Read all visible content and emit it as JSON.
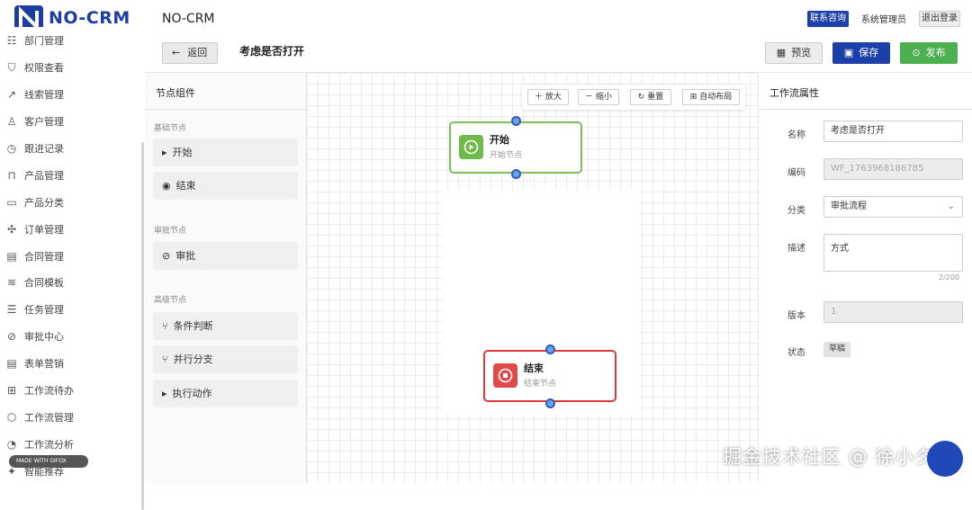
{
  "brand": {
    "name": "NO-CRM"
  },
  "header": {
    "app_title": "NO-CRM",
    "contact_label": "联系咨询",
    "user_label": "系统管理员",
    "logout_label": "退出登录"
  },
  "subheader": {
    "back_label": "返回",
    "page_title": "考虑是否打开",
    "preview_label": "预览",
    "save_label": "保存",
    "publish_label": "发布"
  },
  "sidebar": {
    "items": [
      {
        "label": "部门管理",
        "icon": "users-icon"
      },
      {
        "label": "权限查看",
        "icon": "shield-icon"
      },
      {
        "label": "线索管理",
        "icon": "chart-line-icon"
      },
      {
        "label": "客户管理",
        "icon": "user-icon"
      },
      {
        "label": "跟进记录",
        "icon": "clock-icon"
      },
      {
        "label": "产品管理",
        "icon": "bag-icon"
      },
      {
        "label": "产品分类",
        "icon": "folder-icon"
      },
      {
        "label": "订单管理",
        "icon": "move-icon"
      },
      {
        "label": "合同管理",
        "icon": "file-icon"
      },
      {
        "label": "合同模板",
        "icon": "layers-icon"
      },
      {
        "label": "任务管理",
        "icon": "list-icon"
      },
      {
        "label": "审批中心",
        "icon": "check-circle-icon"
      },
      {
        "label": "表单营销",
        "icon": "form-icon"
      },
      {
        "label": "工作流待办",
        "icon": "grid-icon"
      },
      {
        "label": "工作流管理",
        "icon": "box-icon"
      },
      {
        "label": "工作流分析",
        "icon": "pie-icon"
      },
      {
        "label": "智能推荐",
        "icon": "star-icon"
      }
    ],
    "gifox_label": "MADE WITH GIFOX"
  },
  "components": {
    "title": "节点组件",
    "groups": [
      {
        "label": "基础节点",
        "items": [
          "开始",
          "结束"
        ]
      },
      {
        "label": "审批节点",
        "items": [
          "审批"
        ]
      },
      {
        "label": "高级节点",
        "items": [
          "条件判断",
          "并行分支",
          "执行动作"
        ]
      }
    ]
  },
  "canvas": {
    "toolbar": {
      "zoom_in": "放大",
      "zoom_out": "缩小",
      "reset": "重置",
      "auto_layout": "自动布局"
    },
    "nodes": [
      {
        "name": "开始",
        "sub": "开始节点"
      },
      {
        "name": "结束",
        "sub": "结束节点"
      }
    ]
  },
  "properties": {
    "title": "工作流属性",
    "name_label": "名称",
    "name_value": "考虑是否打开",
    "code_label": "编码",
    "code_value": "WF_1763968186785",
    "category_label": "分类",
    "category_value": "审批流程",
    "desc_label": "描述",
    "desc_value": "方式",
    "desc_counter": "2/200",
    "version_label": "版本",
    "version_value": "1",
    "status_label": "状态",
    "status_value": "草稿"
  },
  "watermark": "掘金技术社区 @ 徐小夕",
  "colors": {
    "primary": "#1d3fa8",
    "success": "#4caf50",
    "start_node": "#6fba4a",
    "end_node": "#e04949",
    "handle": "#2a5dc0"
  }
}
